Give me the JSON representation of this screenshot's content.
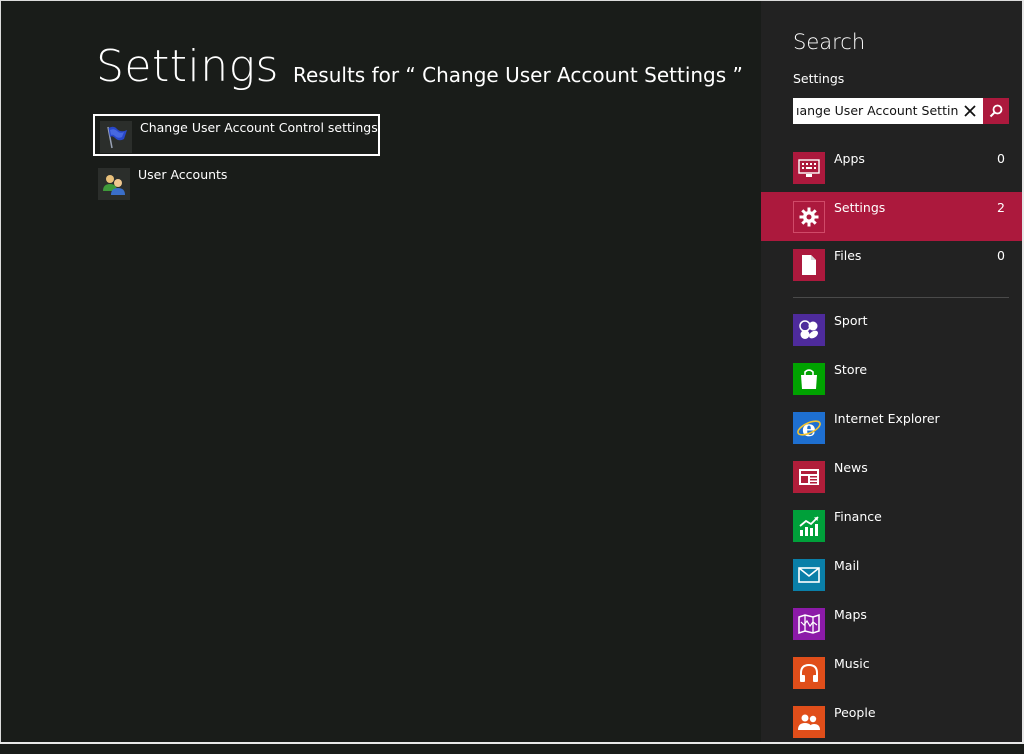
{
  "main": {
    "title": "Settings",
    "results_header": "Results for “ Change User Account Settings ”",
    "results": [
      {
        "label": "Change User Account Control settings",
        "icon": "uac-flag-icon",
        "selected": true
      },
      {
        "label": "User Accounts",
        "icon": "user-accounts-icon",
        "selected": false
      }
    ]
  },
  "charm": {
    "title": "Search",
    "scope": "Settings",
    "search": {
      "value": "Change User Account Settings",
      "visible_text": "ıange User Account Settings"
    },
    "categories": [
      {
        "label": "Apps",
        "count": "0",
        "icon": "apps-keyboard-icon",
        "color": "#ac193d",
        "active": false
      },
      {
        "label": "Settings",
        "count": "2",
        "icon": "gear-icon",
        "color": "#ac193d",
        "active": true
      },
      {
        "label": "Files",
        "count": "0",
        "icon": "file-icon",
        "color": "#ac193d",
        "active": false
      }
    ],
    "apps": [
      {
        "label": "Sport",
        "icon": "sport-balls-icon",
        "color": "#4e2b9c"
      },
      {
        "label": "Store",
        "icon": "store-bag-icon",
        "color": "#00a300"
      },
      {
        "label": "Internet Explorer",
        "icon": "internet-explorer-icon",
        "color": "#1e6fd0"
      },
      {
        "label": "News",
        "icon": "news-icon",
        "color": "#b01e3a"
      },
      {
        "label": "Finance",
        "icon": "finance-chart-icon",
        "color": "#00a03a"
      },
      {
        "label": "Mail",
        "icon": "mail-icon",
        "color": "#0a7fa8"
      },
      {
        "label": "Maps",
        "icon": "maps-icon",
        "color": "#8c1aa8"
      },
      {
        "label": "Music",
        "icon": "headphones-icon",
        "color": "#e04e1a"
      },
      {
        "label": "People",
        "icon": "people-icon",
        "color": "#e04e1a"
      }
    ]
  }
}
